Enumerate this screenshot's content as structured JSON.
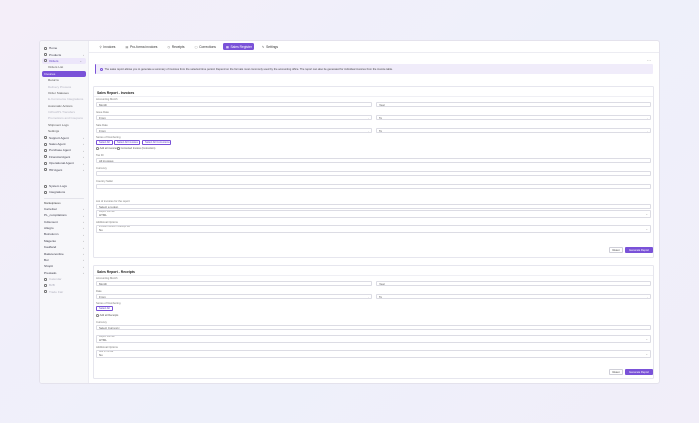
{
  "sidebar": {
    "items": [
      {
        "label": "Home",
        "icon": "home-icon",
        "muted": false
      },
      {
        "label": "Products",
        "icon": "box-icon",
        "chevron": true
      },
      {
        "label": "Orders",
        "icon": "cart-icon",
        "chevron": true,
        "state": "highlighted"
      },
      {
        "label": "Orders List",
        "sub": true
      },
      {
        "label": "Invoices",
        "state": "active"
      },
      {
        "label": "Returns",
        "sub": false
      },
      {
        "label": "Delivery Process",
        "sub": true,
        "muted": true
      },
      {
        "label": "Order Statuses",
        "sub": false
      },
      {
        "label": "E-Commerce Integrations",
        "sub": true,
        "muted": true
      },
      {
        "label": "Automatic Actions",
        "sub": false
      },
      {
        "label": "InPost/PL Transfers",
        "sub": true,
        "muted": true
      },
      {
        "label": "Promotions and Coupons",
        "sub": true,
        "muted": true
      },
      {
        "label": "Shipment Logs",
        "sub": false
      },
      {
        "label": "Settings",
        "sub": false
      },
      {
        "label": "Support Agent",
        "icon": "headset-icon",
        "chevron": true
      },
      {
        "label": "Sales Agent",
        "icon": "tag-icon",
        "chevron": true
      },
      {
        "label": "Purchase Agent",
        "icon": "bag-icon",
        "chevron": true
      },
      {
        "label": "Financial Agent",
        "icon": "coin-icon",
        "chevron": true
      },
      {
        "label": "Operational Agent",
        "icon": "cog-icon",
        "chevron": true
      },
      {
        "label": "HR Agent",
        "icon": "user-icon",
        "chevron": true
      }
    ],
    "bottom": [
      {
        "label": "System Logs",
        "icon": "log-icon"
      },
      {
        "label": "Integrations",
        "icon": "plug-icon"
      }
    ],
    "section_label": "Marketplaces",
    "marketplaces": [
      {
        "label": "Carrefour",
        "chevron": true
      },
      {
        "label": "PL_compilations",
        "chevron": true
      },
      {
        "label": "Cdiscount",
        "chevron": true
      },
      {
        "label": "Allegro",
        "chevron": true
      },
      {
        "label": "Bolcolumn",
        "chevron": true
      },
      {
        "label": "Magento",
        "chevron": true
      },
      {
        "label": "Kaufland",
        "chevron": true
      },
      {
        "label": "Rakutenonline",
        "chevron": true
      },
      {
        "label": "Bol",
        "chevron": true
      },
      {
        "label": "Shoptt",
        "chevron": true
      },
      {
        "label": "Prestado",
        "chevron": true
      },
      {
        "label": "Calendar",
        "muted": true
      },
      {
        "label": "B2B",
        "muted": true
      },
      {
        "label": "Trade Fair",
        "muted": true
      }
    ]
  },
  "tabs": [
    {
      "label": "Invoices",
      "icon": "⚲"
    },
    {
      "label": "Pro-forma invoices",
      "icon": "▤"
    },
    {
      "label": "Receipts",
      "icon": "◷"
    },
    {
      "label": "Corrections",
      "icon": "▢"
    },
    {
      "label": "Sales Register",
      "icon": "▦",
      "active": true
    },
    {
      "label": "Settings",
      "icon": "✎"
    }
  ],
  "notice": "The sales report allows you to generate a summary of invoices from the selected time period. Depend on the formats most commonly used by the accounting office. The report can also be generated for individual invoices from the invoice table.",
  "invoice_report": {
    "title": "Sales Report - Invoices",
    "accounting_month_label": "Accounting Month",
    "month_value": "Month",
    "year_value": "Year",
    "issue_date_label": "Issue Date",
    "from_value": "From",
    "to_value": "To",
    "sale_date_label": "Sale Date",
    "series_label": "Series of Numbering",
    "series_buttons": [
      "Select All",
      "Select All Invoices",
      "Select All Corrections"
    ],
    "checkbox_1": "Add all invoices",
    "checkbox_2": "Corrected Invoice (Correction)",
    "tax_id_label": "Tax ID",
    "tax_id_value": "All invoices",
    "currency_label": "Currency",
    "country_label": "Country Seller",
    "list_label": "List of invoices for the report",
    "select_region": "Select a region",
    "report_format_label": "Report Format",
    "report_format_value": "HTML",
    "additional_label": "Additional Options",
    "additional_small": "Include Invoice in Receipt file",
    "additional_value": "No",
    "reset": "Reset",
    "generate": "Generate Report"
  },
  "receipt_report": {
    "title": "Sales Report - Receipts",
    "accounting_month_label": "Accounting Month",
    "month_value": "Month",
    "year_value": "Year",
    "date_label": "Date",
    "from_value": "From",
    "to_value": "To",
    "series_label": "Series of Numbering",
    "series_button": "Select All",
    "checkbox": "Add all Receipts",
    "currency_label": "Currency",
    "currency_value": "Select Currency",
    "report_format_label": "Report Format",
    "report_format_value": "HTML",
    "additional_label": "Additional Options",
    "additional_small": "Add in format",
    "additional_value": "No",
    "reset": "Reset",
    "generate": "Generate Report"
  }
}
